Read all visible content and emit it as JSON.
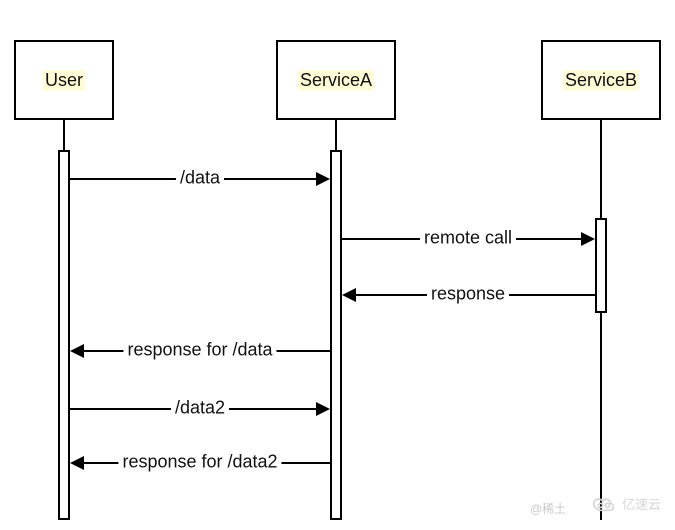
{
  "chart_data": {
    "type": "sequence-diagram",
    "participants": [
      "User",
      "ServiceA",
      "ServiceB"
    ],
    "messages": [
      {
        "from": "User",
        "to": "ServiceA",
        "label": "/data",
        "direction": "request"
      },
      {
        "from": "ServiceA",
        "to": "ServiceB",
        "label": "remote call",
        "direction": "request"
      },
      {
        "from": "ServiceB",
        "to": "ServiceA",
        "label": "response",
        "direction": "response"
      },
      {
        "from": "ServiceA",
        "to": "User",
        "label": "response for /data",
        "direction": "response"
      },
      {
        "from": "User",
        "to": "ServiceA",
        "label": "/data2",
        "direction": "request"
      },
      {
        "from": "ServiceA",
        "to": "User",
        "label": "response for /data2",
        "direction": "response"
      }
    ]
  },
  "participants": {
    "user": {
      "label": "User"
    },
    "serviceA": {
      "label": "ServiceA"
    },
    "serviceB": {
      "label": "ServiceB"
    }
  },
  "messages": {
    "m1": "/data",
    "m2": "remote call",
    "m3": "response",
    "m4": "response for /data",
    "m5": "/data2",
    "m6": "response for /data2"
  },
  "watermarks": {
    "w1": "@稀土",
    "w2": "亿速云"
  }
}
